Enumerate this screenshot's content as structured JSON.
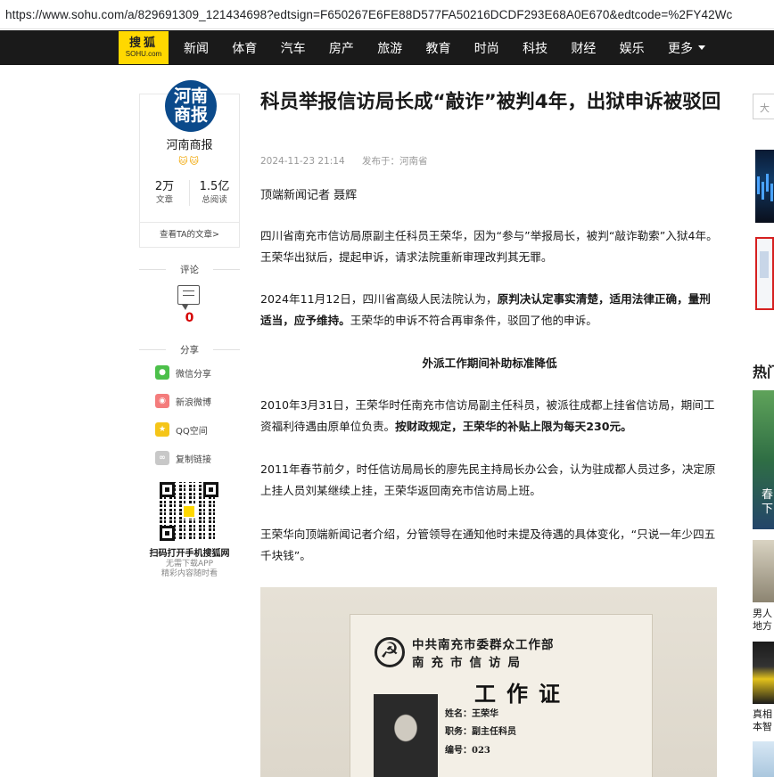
{
  "browser": {
    "url_prefix": "https://www.",
    "url_host": "sohu.com",
    "url_rest": "/a/829691309_121434698?edtsign=F650267E6FE88D577FA50216DCDF293E68A0E670&edtcode=%2FY42Wc"
  },
  "nav": {
    "logo_cn": "搜狐",
    "logo_en": "SOHU.com",
    "items": [
      "新闻",
      "体育",
      "汽车",
      "房产",
      "旅游",
      "教育",
      "时尚",
      "科技",
      "财经",
      "娱乐"
    ],
    "more_label": "更多"
  },
  "author": {
    "avatar_line1": "河南",
    "avatar_line2": "商报",
    "name": "河南商报",
    "badges": "🐱🐱",
    "articles_count": "2万",
    "articles_label": "文章",
    "reads_count": "1.5亿",
    "reads_label": "总阅读",
    "see_all": "查看TA的文章>"
  },
  "comment": {
    "label": "评论",
    "count": "0"
  },
  "share": {
    "label": "分享",
    "items": [
      {
        "label": "微信分享",
        "icon": "wechat-icon",
        "color": "#4cc04a"
      },
      {
        "label": "新浪微博",
        "icon": "weibo-icon",
        "color": "#f47c7c"
      },
      {
        "label": "QQ空间",
        "icon": "qzone-icon",
        "color": "#f5c518"
      },
      {
        "label": "复制链接",
        "icon": "link-icon",
        "color": "#c8c8c8"
      }
    ]
  },
  "qr": {
    "caption": "扫码打开手机搜狐网",
    "sub1": "无需下载APP",
    "sub2": "精彩内容随时看"
  },
  "article": {
    "title": "科员举报信访局长成“敲诈”被判4年，出狱申诉被驳回",
    "date": "2024-11-23 21:14",
    "published_in": "发布于：河南省",
    "byline": "顶端新闻记者 聂辉",
    "p1": "四川省南充市信访局原副主任科员王荣华，因为“参与”举报局长，被判“敲诈勒索”入狱4年。王荣华出狱后，提起申诉，请求法院重新审理改判其无罪。",
    "p2_a": "2024年11月12日，四川省高级人民法院认为，",
    "p2_b": "原判决认定事实清楚，适用法律正确，量刑适当，应予维持。",
    "p2_c": "王荣华的申诉不符合再审条件，驳回了他的申诉。",
    "subhead": "外派工作期间补助标准降低",
    "p3_a": "2010年3月31日，王荣华时任南充市信访局副主任科员，被派往成都上挂省信访局，期间工资福利待遇由原单位负责。",
    "p3_b": "按财政规定，王荣华的补贴上限为每天230元。",
    "p4": "2011年春节前夕，时任信访局局长的廖先民主持局长办公会，认为驻成都人员过多，决定原上挂人员刘某继续上挂，王荣华返回南充市信访局上班。",
    "p5": "王荣华向顶端新闻记者介绍，分管领导在通知他时未提及待遇的具体变化，“只说一年少四五千块钱”。"
  },
  "photo": {
    "org1": "中共南充市委群众工作部",
    "org2": "南充市信访局",
    "card_title": "工作证",
    "name_field": "姓名：王荣华",
    "post_field": "职务：副主任科员",
    "num_field": "编号：023"
  },
  "sidebar": {
    "search_placeholder": "大",
    "hot_label": "热门",
    "hot1_caption_l1": "春",
    "hot1_caption_l2": "下",
    "hot2_l1": "男人",
    "hot2_l2": "地方",
    "hot3_l1": "真相",
    "hot3_l2": "本智"
  }
}
